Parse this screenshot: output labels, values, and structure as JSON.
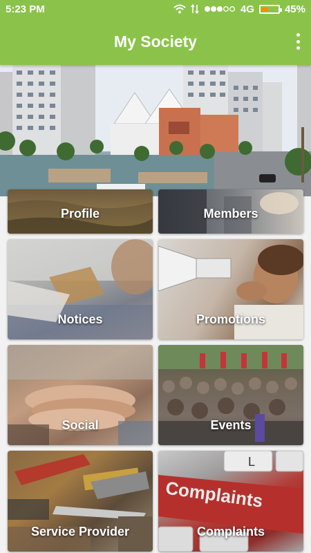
{
  "status_bar": {
    "time": "5:23 PM",
    "network": "4G",
    "battery_percent": "45%",
    "battery_level": 0.45
  },
  "app_bar": {
    "title": "My Society"
  },
  "tiles": [
    {
      "label": "Profile"
    },
    {
      "label": "Members"
    },
    {
      "label": "Notices"
    },
    {
      "label": "Promotions"
    },
    {
      "label": "Social"
    },
    {
      "label": "Events"
    },
    {
      "label": "Service Provider"
    },
    {
      "label": "Complaints"
    }
  ],
  "complaints_key_text": "Complaints",
  "colors": {
    "primary": "#8bc34a",
    "battery": "#ff8c00"
  }
}
